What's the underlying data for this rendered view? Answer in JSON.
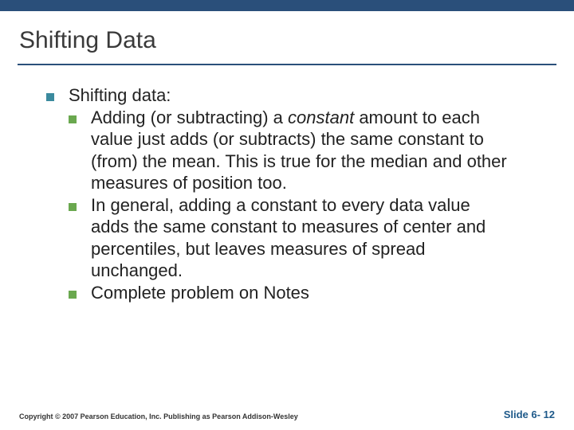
{
  "title": "Shifting Data",
  "lvl1_label": "Shifting data:",
  "bullets": [
    {
      "pre": "Adding (or subtracting) a ",
      "em": "constant",
      "post": " amount to each value just adds (or subtracts) the same constant to (from) the mean. This is true for the median and other measures of position too."
    },
    {
      "pre": "In general, adding a constant to every data value adds the same constant to measures of center and percentiles, but leaves measures of spread unchanged.",
      "em": "",
      "post": ""
    },
    {
      "pre": "Complete problem on Notes",
      "em": "",
      "post": ""
    }
  ],
  "footer": {
    "copyright": "Copyright © 2007 Pearson Education, Inc. Publishing as Pearson Addison-Wesley",
    "slide": "Slide 6- 12"
  }
}
